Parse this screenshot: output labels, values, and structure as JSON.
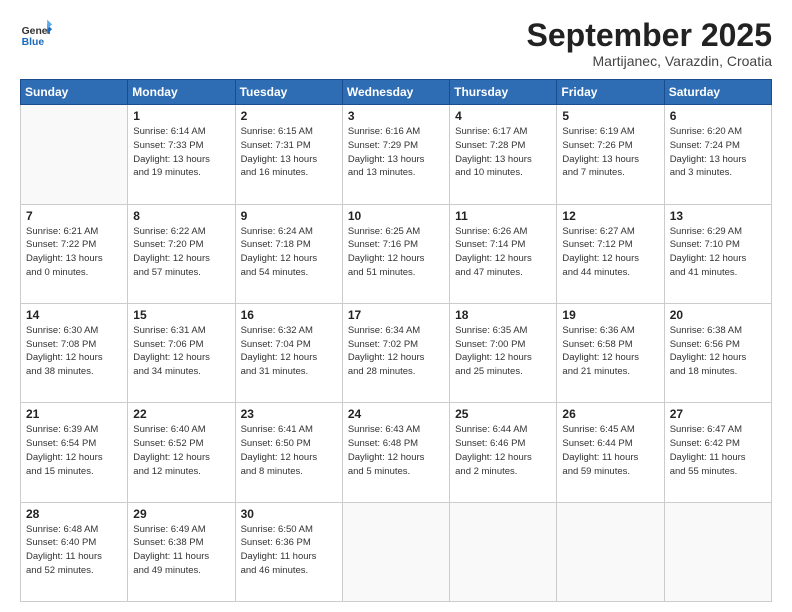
{
  "header": {
    "logo_general": "General",
    "logo_blue": "Blue",
    "month_title": "September 2025",
    "location": "Martijanec, Varazdin, Croatia"
  },
  "weekdays": [
    "Sunday",
    "Monday",
    "Tuesday",
    "Wednesday",
    "Thursday",
    "Friday",
    "Saturday"
  ],
  "weeks": [
    [
      {
        "day": "",
        "info": ""
      },
      {
        "day": "1",
        "info": "Sunrise: 6:14 AM\nSunset: 7:33 PM\nDaylight: 13 hours\nand 19 minutes."
      },
      {
        "day": "2",
        "info": "Sunrise: 6:15 AM\nSunset: 7:31 PM\nDaylight: 13 hours\nand 16 minutes."
      },
      {
        "day": "3",
        "info": "Sunrise: 6:16 AM\nSunset: 7:29 PM\nDaylight: 13 hours\nand 13 minutes."
      },
      {
        "day": "4",
        "info": "Sunrise: 6:17 AM\nSunset: 7:28 PM\nDaylight: 13 hours\nand 10 minutes."
      },
      {
        "day": "5",
        "info": "Sunrise: 6:19 AM\nSunset: 7:26 PM\nDaylight: 13 hours\nand 7 minutes."
      },
      {
        "day": "6",
        "info": "Sunrise: 6:20 AM\nSunset: 7:24 PM\nDaylight: 13 hours\nand 3 minutes."
      }
    ],
    [
      {
        "day": "7",
        "info": "Sunrise: 6:21 AM\nSunset: 7:22 PM\nDaylight: 13 hours\nand 0 minutes."
      },
      {
        "day": "8",
        "info": "Sunrise: 6:22 AM\nSunset: 7:20 PM\nDaylight: 12 hours\nand 57 minutes."
      },
      {
        "day": "9",
        "info": "Sunrise: 6:24 AM\nSunset: 7:18 PM\nDaylight: 12 hours\nand 54 minutes."
      },
      {
        "day": "10",
        "info": "Sunrise: 6:25 AM\nSunset: 7:16 PM\nDaylight: 12 hours\nand 51 minutes."
      },
      {
        "day": "11",
        "info": "Sunrise: 6:26 AM\nSunset: 7:14 PM\nDaylight: 12 hours\nand 47 minutes."
      },
      {
        "day": "12",
        "info": "Sunrise: 6:27 AM\nSunset: 7:12 PM\nDaylight: 12 hours\nand 44 minutes."
      },
      {
        "day": "13",
        "info": "Sunrise: 6:29 AM\nSunset: 7:10 PM\nDaylight: 12 hours\nand 41 minutes."
      }
    ],
    [
      {
        "day": "14",
        "info": "Sunrise: 6:30 AM\nSunset: 7:08 PM\nDaylight: 12 hours\nand 38 minutes."
      },
      {
        "day": "15",
        "info": "Sunrise: 6:31 AM\nSunset: 7:06 PM\nDaylight: 12 hours\nand 34 minutes."
      },
      {
        "day": "16",
        "info": "Sunrise: 6:32 AM\nSunset: 7:04 PM\nDaylight: 12 hours\nand 31 minutes."
      },
      {
        "day": "17",
        "info": "Sunrise: 6:34 AM\nSunset: 7:02 PM\nDaylight: 12 hours\nand 28 minutes."
      },
      {
        "day": "18",
        "info": "Sunrise: 6:35 AM\nSunset: 7:00 PM\nDaylight: 12 hours\nand 25 minutes."
      },
      {
        "day": "19",
        "info": "Sunrise: 6:36 AM\nSunset: 6:58 PM\nDaylight: 12 hours\nand 21 minutes."
      },
      {
        "day": "20",
        "info": "Sunrise: 6:38 AM\nSunset: 6:56 PM\nDaylight: 12 hours\nand 18 minutes."
      }
    ],
    [
      {
        "day": "21",
        "info": "Sunrise: 6:39 AM\nSunset: 6:54 PM\nDaylight: 12 hours\nand 15 minutes."
      },
      {
        "day": "22",
        "info": "Sunrise: 6:40 AM\nSunset: 6:52 PM\nDaylight: 12 hours\nand 12 minutes."
      },
      {
        "day": "23",
        "info": "Sunrise: 6:41 AM\nSunset: 6:50 PM\nDaylight: 12 hours\nand 8 minutes."
      },
      {
        "day": "24",
        "info": "Sunrise: 6:43 AM\nSunset: 6:48 PM\nDaylight: 12 hours\nand 5 minutes."
      },
      {
        "day": "25",
        "info": "Sunrise: 6:44 AM\nSunset: 6:46 PM\nDaylight: 12 hours\nand 2 minutes."
      },
      {
        "day": "26",
        "info": "Sunrise: 6:45 AM\nSunset: 6:44 PM\nDaylight: 11 hours\nand 59 minutes."
      },
      {
        "day": "27",
        "info": "Sunrise: 6:47 AM\nSunset: 6:42 PM\nDaylight: 11 hours\nand 55 minutes."
      }
    ],
    [
      {
        "day": "28",
        "info": "Sunrise: 6:48 AM\nSunset: 6:40 PM\nDaylight: 11 hours\nand 52 minutes."
      },
      {
        "day": "29",
        "info": "Sunrise: 6:49 AM\nSunset: 6:38 PM\nDaylight: 11 hours\nand 49 minutes."
      },
      {
        "day": "30",
        "info": "Sunrise: 6:50 AM\nSunset: 6:36 PM\nDaylight: 11 hours\nand 46 minutes."
      },
      {
        "day": "",
        "info": ""
      },
      {
        "day": "",
        "info": ""
      },
      {
        "day": "",
        "info": ""
      },
      {
        "day": "",
        "info": ""
      }
    ]
  ]
}
